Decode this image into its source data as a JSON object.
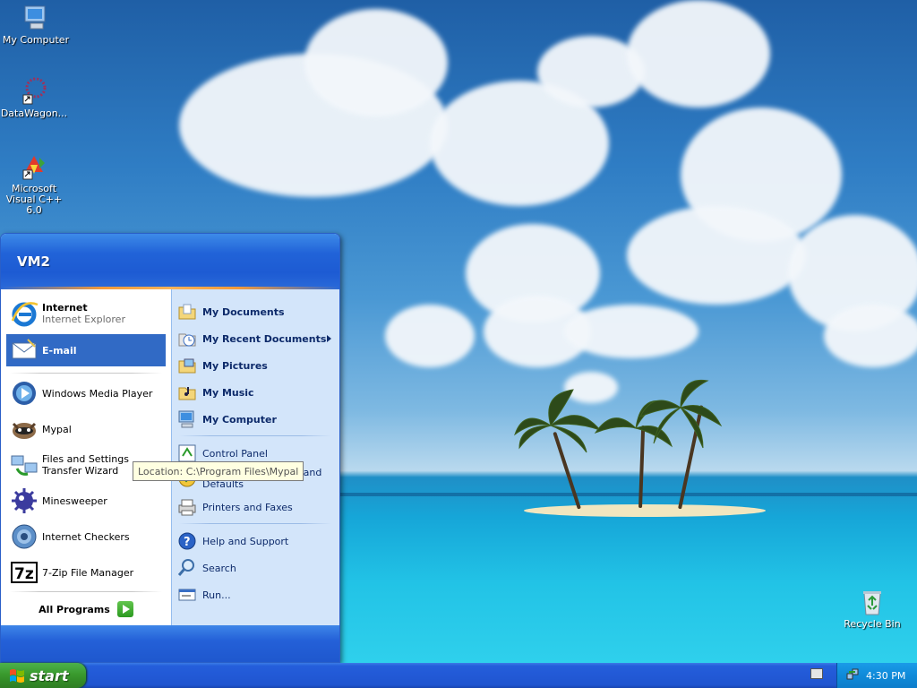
{
  "desktop": {
    "icons": [
      {
        "label": "My Computer",
        "icon": "my-computer-icon"
      },
      {
        "label": "DataWagon...",
        "icon": "datawagon-icon"
      },
      {
        "label": "Microsoft Visual C++ 6.0",
        "icon": "visual-cpp-icon"
      },
      {
        "label": "Recycle Bin",
        "icon": "recycle-bin-icon"
      }
    ]
  },
  "start_menu": {
    "user_name": "VM2",
    "pinned": [
      {
        "title": "Internet",
        "subtitle": "Internet Explorer",
        "icon": "internet-explorer-icon"
      },
      {
        "title": "E-mail",
        "subtitle": "",
        "icon": "email-icon"
      }
    ],
    "recent": [
      {
        "label": "Windows Media Player",
        "icon": "media-player-icon"
      },
      {
        "label": "Mypal",
        "icon": "mypal-icon"
      },
      {
        "label": "Files and Settings Transfer Wizard",
        "icon": "transfer-wizard-icon"
      },
      {
        "label": "Minesweeper",
        "icon": "minesweeper-icon"
      },
      {
        "label": "Internet Checkers",
        "icon": "checkers-icon"
      },
      {
        "label": "7-Zip File Manager",
        "icon": "7zip-icon"
      }
    ],
    "all_programs": "All Programs",
    "places": [
      {
        "label": "My Documents",
        "icon": "folder-documents-icon"
      },
      {
        "label": "My Recent Documents",
        "icon": "recent-documents-icon"
      },
      {
        "label": "My Pictures",
        "icon": "folder-pictures-icon"
      },
      {
        "label": "My Music",
        "icon": "folder-music-icon"
      },
      {
        "label": "My Computer",
        "icon": "my-computer-icon"
      }
    ],
    "system": [
      {
        "label": "Control Panel",
        "icon": "control-panel-icon"
      },
      {
        "label": "Set Program Access and Defaults",
        "icon": "program-access-icon"
      },
      {
        "label": "Printers and Faxes",
        "icon": "printer-icon"
      }
    ],
    "help": [
      {
        "label": "Help and Support",
        "icon": "help-icon"
      },
      {
        "label": "Search",
        "icon": "search-icon"
      },
      {
        "label": "Run...",
        "icon": "run-icon"
      }
    ],
    "tooltip": "Location: C:\\Program Files\\Mypal"
  },
  "taskbar": {
    "start_label": "start",
    "clock": "4:30 PM"
  },
  "colors": {
    "taskbar_blue": "#245edb",
    "start_green": "#3a9a2e",
    "selection": "#316ac5",
    "places_pane": "#d3e5fa"
  }
}
